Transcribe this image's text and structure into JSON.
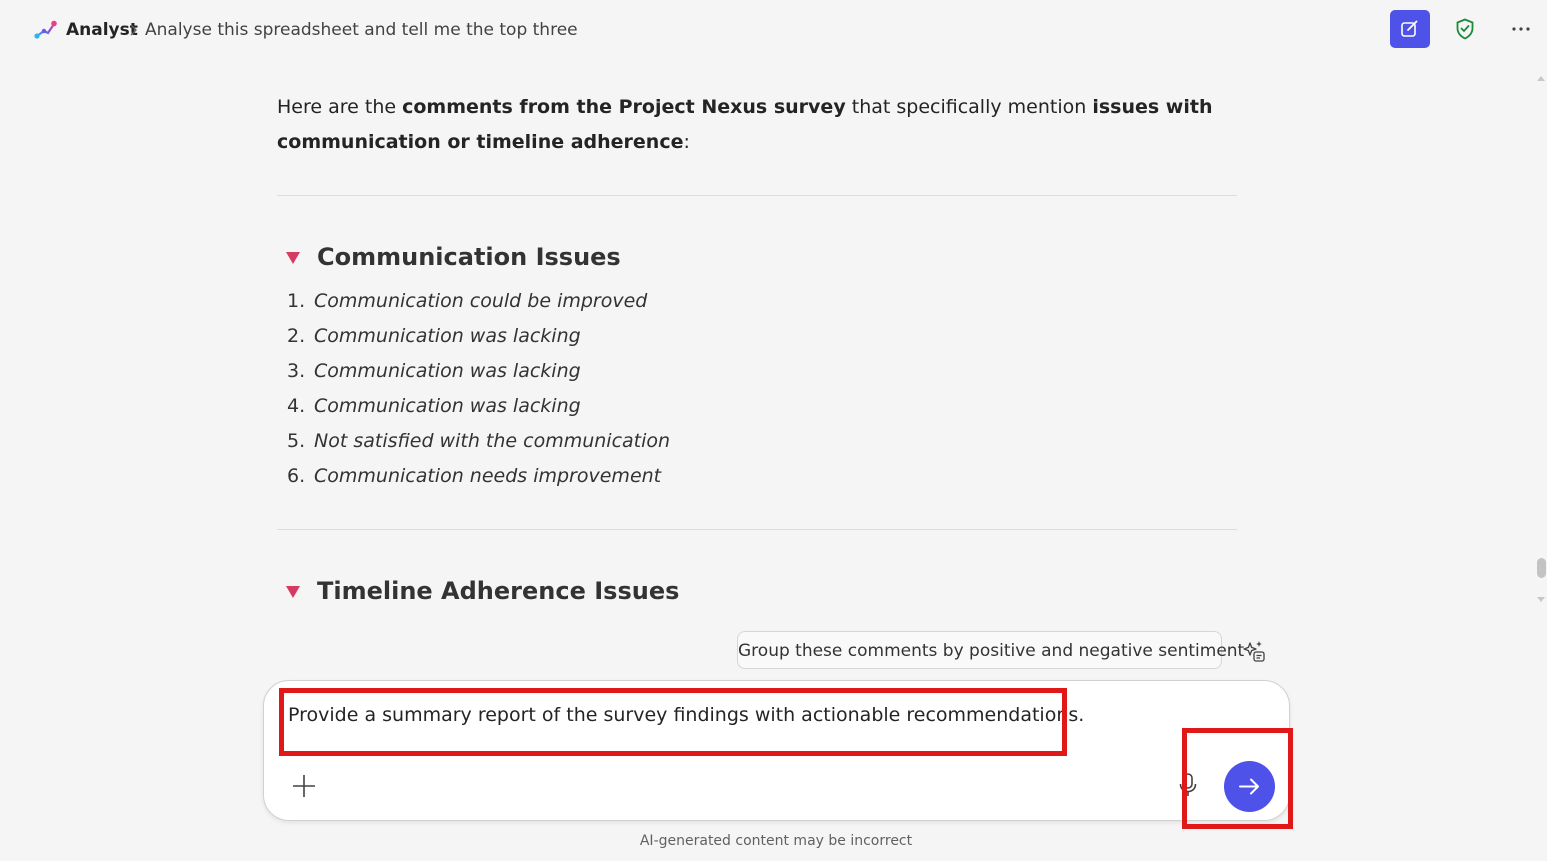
{
  "header": {
    "app_name": "Analyst",
    "conversation_title": "Analyse this spreadsheet and tell me the top three",
    "icons": [
      "analyst-logo-icon",
      "chevron-right-icon",
      "new-chat-icon",
      "shield-check-icon",
      "more-icon"
    ]
  },
  "message": {
    "intro_prefix": "Here are the ",
    "intro_bold1": "comments from the Project Nexus survey",
    "intro_mid": " that specifically mention ",
    "intro_bold2": "issues with communication or timeline adherence",
    "intro_suffix": ":",
    "sections": [
      {
        "title": "Communication Issues",
        "items": [
          {
            "num": "1.",
            "text": "Communication could be improved"
          },
          {
            "num": "2.",
            "text": "Communication was lacking"
          },
          {
            "num": "3.",
            "text": "Communication was lacking"
          },
          {
            "num": "4.",
            "text": "Communication was lacking"
          },
          {
            "num": "5.",
            "text": "Not satisfied with the communication"
          },
          {
            "num": "6.",
            "text": "Communication needs improvement"
          }
        ]
      },
      {
        "title": "Timeline Adherence Issues",
        "items": []
      }
    ]
  },
  "suggestion": {
    "label": "Group these comments by positive and negative sentiment"
  },
  "composer": {
    "text": "Provide a summary report of the survey findings with actionable recommendations."
  },
  "footer": {
    "disclaimer": "AI-generated content may be incorrect"
  },
  "colors": {
    "accent": "#4f52e8",
    "highlight": "#e01818",
    "section_marker": "#d63a63",
    "shield": "#1a8a3a"
  }
}
